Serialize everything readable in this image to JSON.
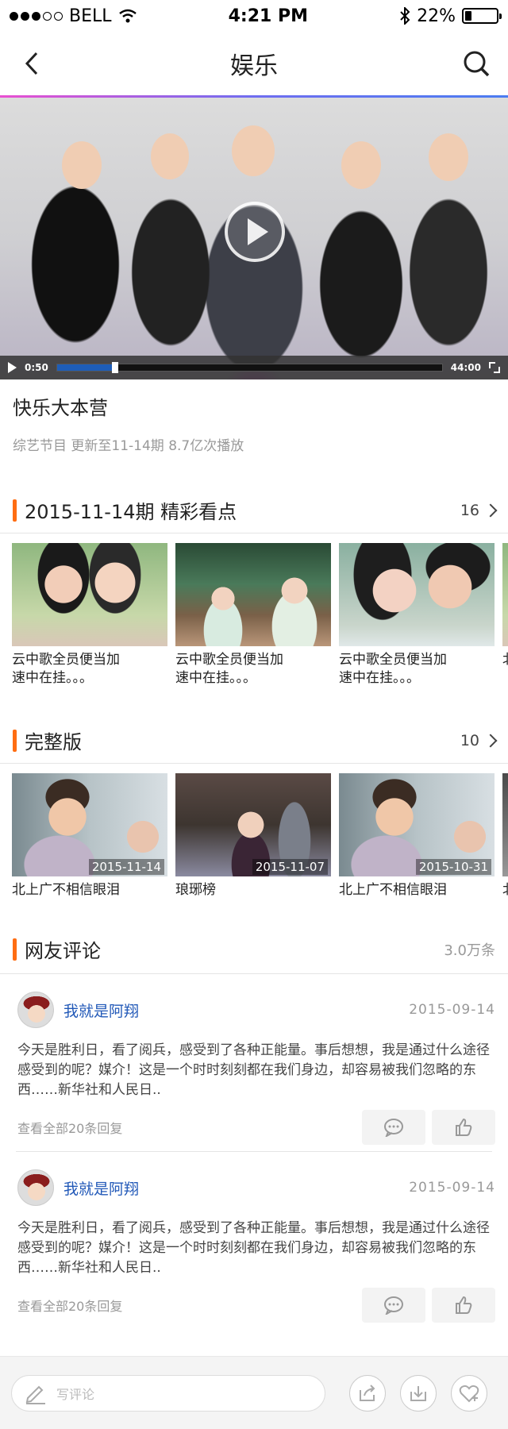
{
  "status": {
    "carrier": "BELL",
    "time": "4:21 PM",
    "battery": "22%"
  },
  "nav": {
    "title": "娱乐"
  },
  "player": {
    "elapsed": "0:50",
    "duration": "44:00",
    "progress_fraction": 0.15
  },
  "show": {
    "title": "快乐大本营",
    "meta": "综艺节目 更新至11-14期  8.7亿次播放"
  },
  "highlights": {
    "title": "2015-11-14期  精彩看点",
    "count": "16",
    "items": [
      {
        "caption": "云中歌全员便当加速中在挂。。。"
      },
      {
        "caption": "云中歌全员便当加速中在挂。。。"
      },
      {
        "caption": "云中歌全员便当加速中在挂。。。"
      },
      {
        "caption": "北"
      }
    ]
  },
  "full": {
    "title": "完整版",
    "count": "10",
    "items": [
      {
        "caption": "北上广不相信眼泪",
        "date": "2015-11-14"
      },
      {
        "caption": "琅琊榜",
        "date": "2015-11-07"
      },
      {
        "caption": "北上广不相信眼泪",
        "date": "2015-10-31"
      },
      {
        "caption": "北",
        "date": ""
      }
    ]
  },
  "comments": {
    "title": "网友评论",
    "count": "3.0万条",
    "items": [
      {
        "user": "我就是阿翔",
        "date": "2015-09-14",
        "text": "今天是胜利日，看了阅兵，感受到了各种正能量。事后想想，我是通过什么途径感受到的呢？媒介！这是一个时时刻刻都在我们身边，却容易被我们忽略的东西……新华社和人民日..",
        "view_all": "查看全部20条回复"
      },
      {
        "user": "我就是阿翔",
        "date": "2015-09-14",
        "text": "今天是胜利日，看了阅兵，感受到了各种正能量。事后想想，我是通过什么途径感受到的呢？媒介！这是一个时时刻刻都在我们身边，却容易被我们忽略的东西……新华社和人民日..",
        "view_all": "查看全部20条回复"
      }
    ]
  },
  "bottom": {
    "placeholder": "写评论"
  },
  "colors": {
    "accent": "#ff6d12",
    "link": "#2259b8",
    "progress": "#1e5db8"
  },
  "icons": [
    "back-icon",
    "search-icon",
    "play-icon",
    "fullscreen-icon",
    "chevron-right-icon",
    "comment-icon",
    "thumbs-up-icon",
    "pencil-icon",
    "share-icon",
    "download-icon",
    "favorite-icon",
    "wifi-icon",
    "bluetooth-icon",
    "battery-icon"
  ]
}
